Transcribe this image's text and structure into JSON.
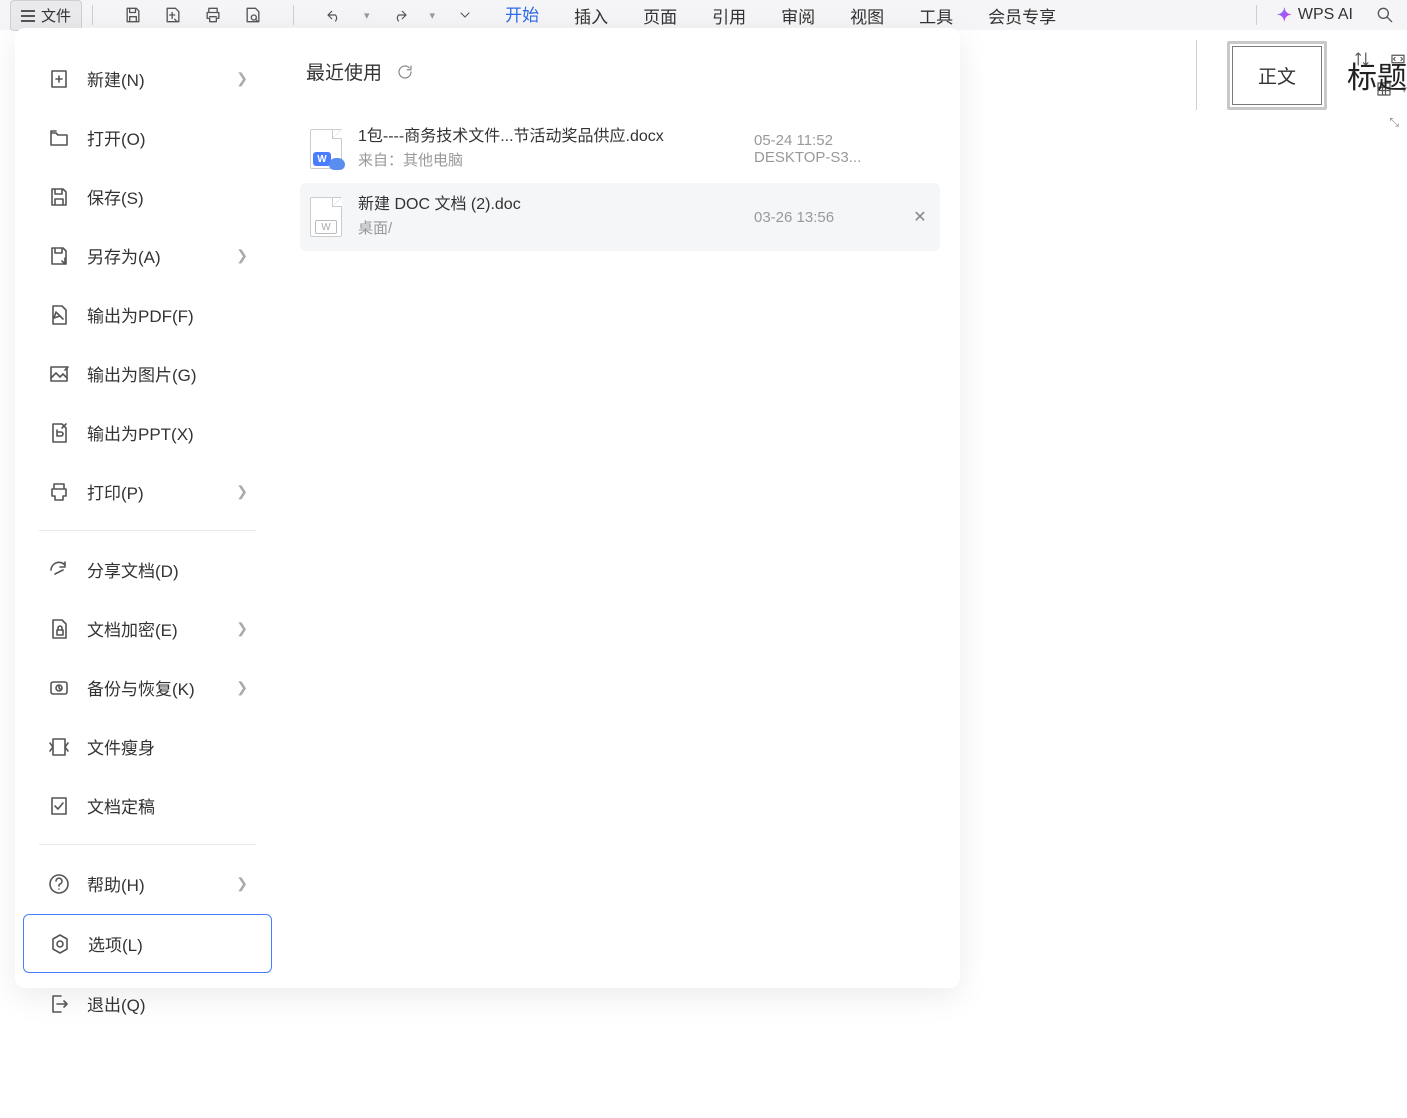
{
  "toolbar": {
    "file_label": "文件",
    "wps_ai": "WPS AI"
  },
  "ribbon_tabs": [
    "开始",
    "插入",
    "页面",
    "引用",
    "审阅",
    "视图",
    "工具",
    "会员专享"
  ],
  "ribbon_active_index": 0,
  "styles": {
    "normal": "正文",
    "title": "标题"
  },
  "file_menu": [
    {
      "icon": "new",
      "label": "新建(N)",
      "chevron": true
    },
    {
      "icon": "open",
      "label": "打开(O)"
    },
    {
      "icon": "save",
      "label": "保存(S)"
    },
    {
      "icon": "saveas",
      "label": "另存为(A)",
      "chevron": true
    },
    {
      "icon": "pdf",
      "label": "输出为PDF(F)"
    },
    {
      "icon": "image",
      "label": "输出为图片(G)"
    },
    {
      "icon": "ppt",
      "label": "输出为PPT(X)"
    },
    {
      "icon": "print",
      "label": "打印(P)",
      "chevron": true,
      "sep_after": true
    },
    {
      "icon": "share",
      "label": "分享文档(D)"
    },
    {
      "icon": "encrypt",
      "label": "文档加密(E)",
      "chevron": true
    },
    {
      "icon": "backup",
      "label": "备份与恢复(K)",
      "chevron": true
    },
    {
      "icon": "slim",
      "label": "文件瘦身"
    },
    {
      "icon": "final",
      "label": "文档定稿",
      "sep_after": true
    },
    {
      "icon": "help",
      "label": "帮助(H)",
      "chevron": true
    },
    {
      "icon": "options",
      "label": "选项(L)",
      "selected": true
    },
    {
      "icon": "exit",
      "label": "退出(Q)"
    }
  ],
  "recent": {
    "title": "最近使用",
    "files": [
      {
        "name": "1包----商务技术文件...节活动奖品供应.docx",
        "source": "来自：其他电脑",
        "time": "05-24 11:52",
        "device": "DESKTOP-S3...",
        "type": "docx-cloud"
      },
      {
        "name": "新建 DOC 文档 (2).doc",
        "source": "桌面/",
        "time": "03-26 13:56",
        "device": "",
        "type": "doc",
        "hover": true
      }
    ]
  }
}
